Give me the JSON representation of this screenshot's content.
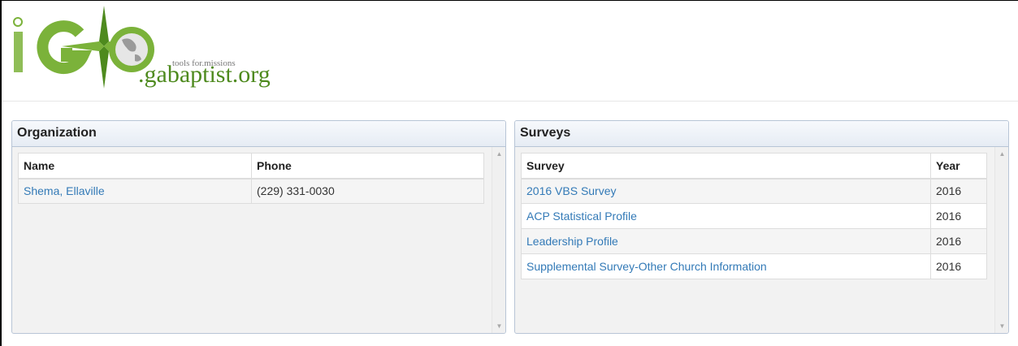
{
  "header": {
    "logo": {
      "wordmark": "iGO",
      "tagline": "tools for.missions",
      "domain": ".gabaptist.org",
      "colors": {
        "green": "#7bb23a",
        "dark_green": "#4e8a1e"
      }
    }
  },
  "organization": {
    "title": "Organization",
    "columns": [
      "Name",
      "Phone"
    ],
    "rows": [
      {
        "name": "Shema, Ellaville",
        "phone": "(229) 331-0030"
      }
    ]
  },
  "surveys": {
    "title": "Surveys",
    "columns": [
      "Survey",
      "Year"
    ],
    "rows": [
      {
        "survey": "2016 VBS Survey",
        "year": "2016"
      },
      {
        "survey": "ACP Statistical Profile",
        "year": "2016"
      },
      {
        "survey": "Leadership Profile",
        "year": "2016"
      },
      {
        "survey": "Supplemental Survey-Other Church Information",
        "year": "2016"
      }
    ]
  },
  "scroll_icons": {
    "up": "scroll-up-arrow-icon",
    "down": "scroll-down-arrow-icon"
  },
  "colors": {
    "link": "#337ab7",
    "panel_border": "#b8c5d6",
    "panel_bg": "#f2f2f2"
  }
}
